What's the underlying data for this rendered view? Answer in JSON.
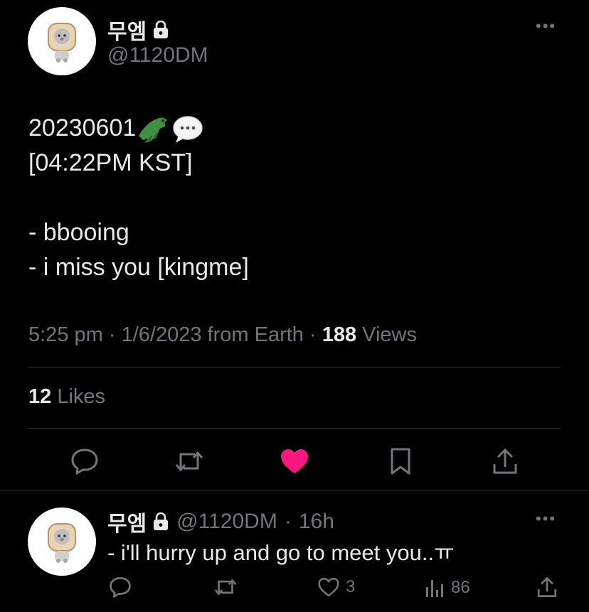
{
  "tweet": {
    "display_name": "무엠",
    "handle": "@1120DM",
    "more": "•••",
    "line1": "20230601",
    "line2": "[04:22PM KST]",
    "line3": "- bbooing",
    "line4": "- i miss you [kingme]",
    "time": "5:25 pm",
    "date": "1/6/2023",
    "source": "from Earth",
    "views_count": "188",
    "views_label": "Views",
    "likes_count": "12",
    "likes_label": "Likes"
  },
  "actions": {
    "icons": [
      "reply-icon",
      "retweet-icon",
      "like-icon",
      "bookmark-icon",
      "share-icon"
    ],
    "like_color": "#f91880"
  },
  "reply": {
    "display_name": "무엠",
    "handle": "@1120DM",
    "sep": "·",
    "age": "16h",
    "more": "•••",
    "text": "- i'll hurry up and go to meet you..ㅠ",
    "likes": "3",
    "views": "86"
  },
  "colors": {
    "background": "#000000",
    "text": "#e7e9ea",
    "muted": "#71767b",
    "divider": "#2f3336"
  }
}
